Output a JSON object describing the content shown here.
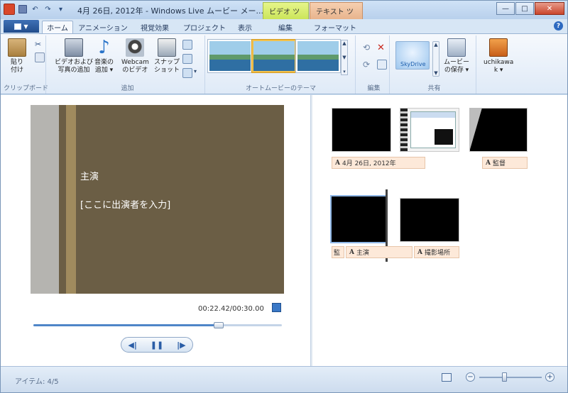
{
  "window": {
    "title": "4月 26日, 2012年 - Windows Live ムービー メー...",
    "context_tabs": {
      "video_tools": "ビデオ ツール",
      "text_tools": "テキスト ツール"
    }
  },
  "ribbon_tabs": [
    "ホーム",
    "アニメーション",
    "視覚効果",
    "プロジェクト",
    "表示",
    "編集",
    "フォーマット"
  ],
  "ribbon": {
    "clipboard": {
      "paste": "貼り\n付け",
      "group": "クリップボード"
    },
    "add": {
      "add_videos_photos": "ビデオおよび\n写真の追加",
      "add_music": "音楽の\n追加 ▾",
      "webcam_video": "Webcam\nのビデオ",
      "snapshot": "スナップ\nショット",
      "group": "追加"
    },
    "automovie": {
      "group": "オートムービーのテーマ"
    },
    "editing": {
      "group": "編集"
    },
    "share": {
      "skydrive": "SkyDrive",
      "save_movie": "ムービー\nの保存 ▾",
      "user": "uchikawa\nk ▾",
      "group": "共有"
    }
  },
  "preview": {
    "title_line1": "主演",
    "title_line2": "[ここに出演者を入力]",
    "timecode": "00:22.42/00:30.00",
    "seek_fraction": 0.747
  },
  "storyboard": {
    "captions": {
      "c1": "4月 26日, 2012年",
      "c2": "監督",
      "c3_prefix": "監",
      "c3": "主演",
      "c4": "撮影場所"
    }
  },
  "status": {
    "items": "アイテム: 4/5",
    "zoom_fraction": 0.4
  }
}
